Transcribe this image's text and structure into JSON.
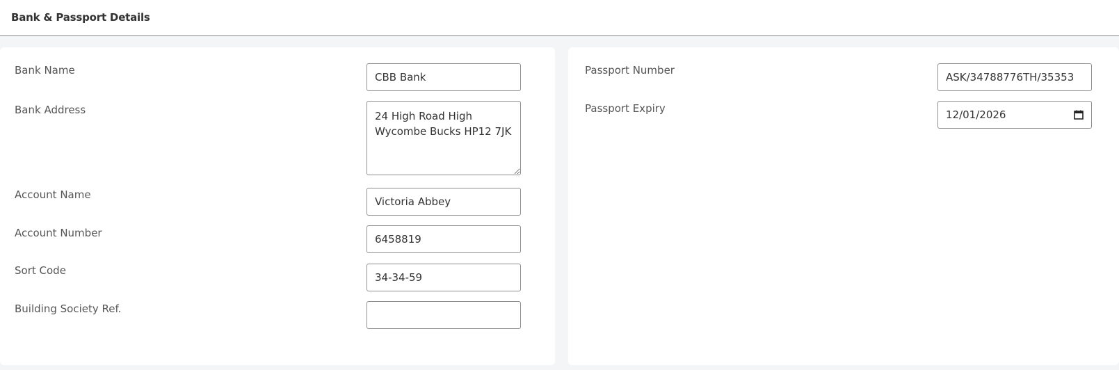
{
  "header": {
    "title": "Bank & Passport Details"
  },
  "bank": {
    "bank_name": {
      "label": "Bank Name",
      "value": "CBB Bank"
    },
    "bank_address": {
      "label": "Bank Address",
      "value": "24 High Road High\nWycombe Bucks HP12 7JK"
    },
    "account_name": {
      "label": "Account Name",
      "value": "Victoria Abbey"
    },
    "account_number": {
      "label": "Account Number",
      "value": "6458819"
    },
    "sort_code": {
      "label": "Sort Code",
      "value": "34-34-59"
    },
    "building_society_ref": {
      "label": "Building Society Ref.",
      "value": ""
    }
  },
  "passport": {
    "passport_number": {
      "label": "Passport Number",
      "value": "ASK/34788776TH/35353"
    },
    "passport_expiry": {
      "label": "Passport Expiry",
      "value": "12/01/2026",
      "icon": "calendar-icon"
    }
  }
}
